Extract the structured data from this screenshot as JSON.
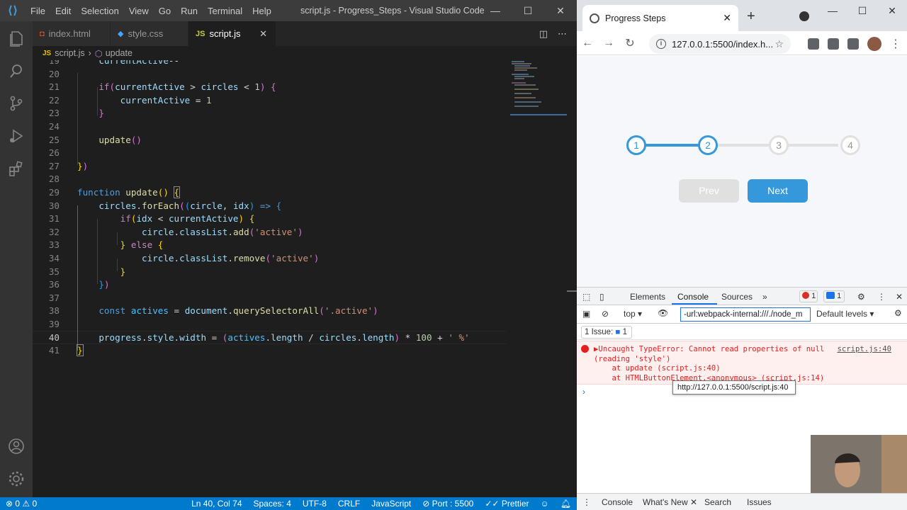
{
  "vscode": {
    "menu": [
      "File",
      "Edit",
      "Selection",
      "View",
      "Go",
      "Run",
      "Terminal",
      "Help"
    ],
    "window_title": "script.js - Progress_Steps - Visual Studio Code",
    "tabs": [
      {
        "label": "index.html",
        "icon": "html-file-icon",
        "icon_color": "#e44d26"
      },
      {
        "label": "style.css",
        "icon": "css-file-icon",
        "icon_color": "#42a5f5"
      },
      {
        "label": "script.js",
        "icon": "js-file-icon",
        "icon_color": "#cbcb41",
        "active": true
      }
    ],
    "breadcrumb": {
      "file": "script.js",
      "symbol": "update"
    },
    "line_numbers": [
      "19",
      "20",
      "21",
      "22",
      "23",
      "24",
      "25",
      "26",
      "27",
      "28",
      "29",
      "30",
      "31",
      "32",
      "33",
      "34",
      "35",
      "36",
      "37",
      "38",
      "39",
      "40",
      "41"
    ],
    "current_line": "40",
    "status": {
      "errors": "0",
      "warnings": "0",
      "position": "Ln 40, Col 74",
      "spaces": "Spaces: 4",
      "encoding": "UTF-8",
      "eol": "CRLF",
      "language": "JavaScript",
      "port": "Port : 5500",
      "prettier": "Prettier"
    }
  },
  "browser": {
    "tab_title": "Progress Steps",
    "url": "127.0.0.1:5500/index.h...",
    "steps": [
      "1",
      "2",
      "3",
      "4"
    ],
    "active_steps": 2,
    "prev_label": "Prev",
    "next_label": "Next",
    "devtools": {
      "tabs": [
        "Elements",
        "Console",
        "Sources"
      ],
      "active_tab": "Console",
      "error_count": "1",
      "message_count": "1",
      "context": "top",
      "filter_value": "-url:webpack-internal:///./node_m",
      "levels": "Default levels",
      "issues": "1 Issue:",
      "issues_count": "1",
      "error_lines": [
        "▶Uncaught TypeError: Cannot read properties of null",
        "(reading 'style')",
        "    at update (script.js:40)",
        "    at HTMLButtonElement.<anonymous> (script.js:14)"
      ],
      "error_source": "script.js:40",
      "tooltip": "http://127.0.0.1:5500/script.js:40",
      "drawer_tabs": [
        "Console",
        "What's New",
        "Search",
        "Issues"
      ]
    }
  }
}
